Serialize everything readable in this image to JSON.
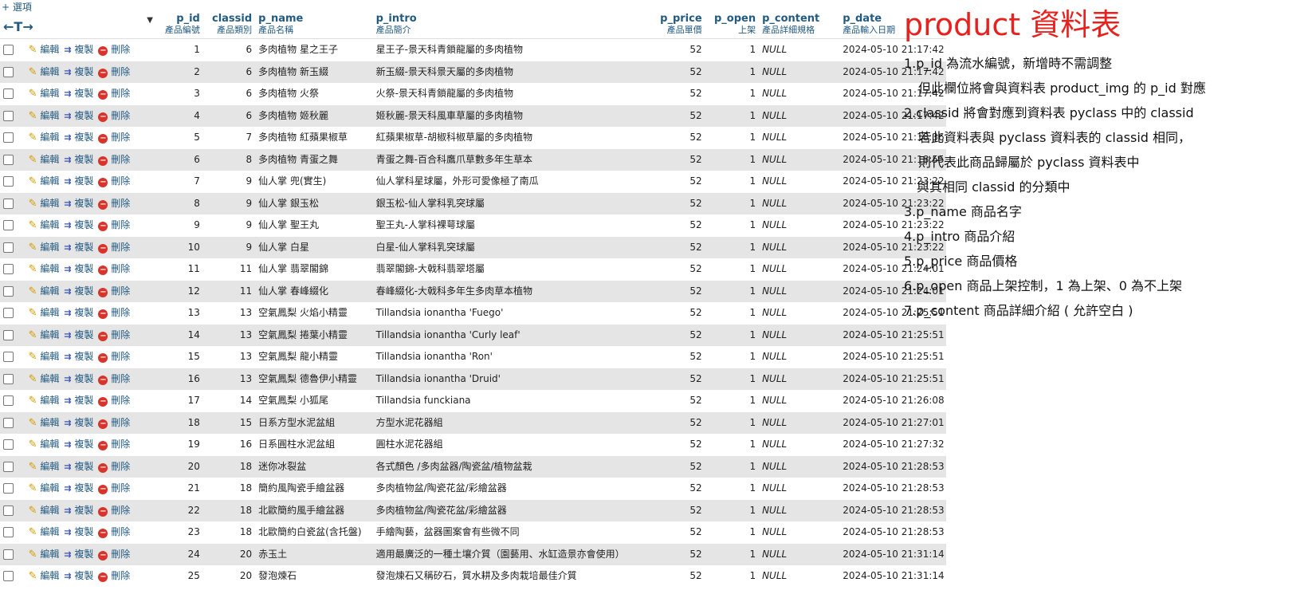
{
  "options_link": "+ 選項",
  "toolbar": {
    "nav_arrows": "←T→"
  },
  "actions": {
    "edit": "編輯",
    "copy": "複製",
    "delete": "刪除"
  },
  "columns": [
    {
      "name": "p_id",
      "desc": "產品編號"
    },
    {
      "name": "classid",
      "desc": "產品類別"
    },
    {
      "name": "p_name",
      "desc": "產品名稱"
    },
    {
      "name": "p_intro",
      "desc": "產品簡介"
    },
    {
      "name": "p_price",
      "desc": "產品單價"
    },
    {
      "name": "p_open",
      "desc": "上架"
    },
    {
      "name": "p_content",
      "desc": "產品詳細規格"
    },
    {
      "name": "p_date",
      "desc": "產品輸入日期"
    }
  ],
  "rows": [
    [
      "1",
      "6",
      "多肉植物 星之王子",
      "星王子-景天科青鎖龍屬的多肉植物",
      "52",
      "1",
      "NULL",
      "2024-05-10 21:17:42"
    ],
    [
      "2",
      "6",
      "多肉植物 新玉綴",
      "新玉綴-景天科景天屬的多肉植物",
      "52",
      "1",
      "NULL",
      "2024-05-10 21:17:42"
    ],
    [
      "3",
      "6",
      "多肉植物 火祭",
      "火祭-景天科青鎖龍屬的多肉植物",
      "52",
      "1",
      "NULL",
      "2024-05-10 21:17:42"
    ],
    [
      "4",
      "6",
      "多肉植物 姬秋麗",
      "姬秋麗-景天科風車草屬的多肉植物",
      "52",
      "1",
      "NULL",
      "2024-05-10 21:17:42"
    ],
    [
      "5",
      "7",
      "多肉植物 紅蘋果椒草",
      "紅蘋果椒草-胡椒科椒草屬的多肉植物",
      "52",
      "1",
      "NULL",
      "2024-05-10 21:18:36"
    ],
    [
      "6",
      "8",
      "多肉植物 青蛋之舞",
      "青蛋之舞-百合科鷹爪草數多年生草本",
      "52",
      "1",
      "NULL",
      "2024-05-10 21:18:55"
    ],
    [
      "7",
      "9",
      "仙人掌 兜(實生)",
      "仙人掌科星球屬，外形可愛像極了南瓜",
      "52",
      "1",
      "NULL",
      "2024-05-10 21:23:22"
    ],
    [
      "8",
      "9",
      "仙人掌 銀玉松",
      "銀玉松-仙人掌科乳突球屬",
      "52",
      "1",
      "NULL",
      "2024-05-10 21:23:22"
    ],
    [
      "9",
      "9",
      "仙人掌 聖王丸",
      "聖王丸-人掌科裸萼球屬",
      "52",
      "1",
      "NULL",
      "2024-05-10 21:23:22"
    ],
    [
      "10",
      "9",
      "仙人掌 白星",
      "白星-仙人掌科乳突球屬",
      "52",
      "1",
      "NULL",
      "2024-05-10 21:23:22"
    ],
    [
      "11",
      "11",
      "仙人掌 翡翠閣錦",
      "翡翠閣錦-大戟科翡翠塔屬",
      "52",
      "1",
      "NULL",
      "2024-05-10 21:24:01"
    ],
    [
      "12",
      "11",
      "仙人掌 春峰綴化",
      "春峰綴化-大戟科多年生多肉草本植物",
      "52",
      "1",
      "NULL",
      "2024-05-10 21:24:01"
    ],
    [
      "13",
      "13",
      "空氣鳳梨 火焰小精靈",
      "Tillandsia ionantha 'Fuego'",
      "52",
      "1",
      "NULL",
      "2024-05-10 21:25:51"
    ],
    [
      "14",
      "13",
      "空氣鳳梨 捲葉小精靈",
      "Tillandsia ionantha 'Curly leaf'",
      "52",
      "1",
      "NULL",
      "2024-05-10 21:25:51"
    ],
    [
      "15",
      "13",
      "空氣鳳梨 龍小精靈",
      "Tillandsia ionantha 'Ron'",
      "52",
      "1",
      "NULL",
      "2024-05-10 21:25:51"
    ],
    [
      "16",
      "13",
      "空氣鳳梨 德魯伊小精靈",
      "Tillandsia ionantha 'Druid'",
      "52",
      "1",
      "NULL",
      "2024-05-10 21:25:51"
    ],
    [
      "17",
      "14",
      "空氣鳳梨 小狐尾",
      "Tillandsia funckiana",
      "52",
      "1",
      "NULL",
      "2024-05-10 21:26:08"
    ],
    [
      "18",
      "15",
      "日系方型水泥盆組",
      "方型水泥花器組",
      "52",
      "1",
      "NULL",
      "2024-05-10 21:27:01"
    ],
    [
      "19",
      "16",
      "日系圓柱水泥盆組",
      "圓柱水泥花器組",
      "52",
      "1",
      "NULL",
      "2024-05-10 21:27:32"
    ],
    [
      "20",
      "18",
      "迷你冰裂盆",
      "各式顏色 /多肉盆器/陶瓷盆/植物盆栽",
      "52",
      "1",
      "NULL",
      "2024-05-10 21:28:53"
    ],
    [
      "21",
      "18",
      "簡約風陶瓷手繪盆器",
      "多肉植物盆/陶瓷花盆/彩繪盆器",
      "52",
      "1",
      "NULL",
      "2024-05-10 21:28:53"
    ],
    [
      "22",
      "18",
      "北歐簡約風手繪盆器",
      "多肉植物盆/陶瓷花盆/彩繪盆器",
      "52",
      "1",
      "NULL",
      "2024-05-10 21:28:53"
    ],
    [
      "23",
      "18",
      "北歐簡約白瓷盆(含托盤)",
      "手繪陶藝，盆器圖案會有些微不同",
      "52",
      "1",
      "NULL",
      "2024-05-10 21:28:53"
    ],
    [
      "24",
      "20",
      "赤玉土",
      "適用最廣泛的一種土壤介質（園藝用、水缸造景亦會使用）",
      "52",
      "1",
      "NULL",
      "2024-05-10 21:31:14"
    ],
    [
      "25",
      "20",
      "發泡煉石",
      "發泡煉石又稱矽石，質水耕及多肉栽培最佳介質",
      "52",
      "1",
      "NULL",
      "2024-05-10 21:31:14"
    ]
  ],
  "notes": {
    "title": "product 資料表",
    "lines": [
      {
        "text": "1.p_id 為流水編號，新增時不需調整",
        "indent": 0
      },
      {
        "text": "但此欄位將會與資料表 product_img 的 p_id 對應",
        "indent": 1
      },
      {
        "text": "2.classid 將會對應到資料表 pyclass 中的 classid",
        "indent": 0
      },
      {
        "text": "若此資料表與 pyclass 資料表的 classid 相同，",
        "indent": 1
      },
      {
        "text": "則代表此商品歸屬於 pyclass 資料表中",
        "indent": 1
      },
      {
        "text": "與其相同 classid 的分類中",
        "indent": 2
      },
      {
        "text": "3.p_name 商品名字",
        "indent": 0
      },
      {
        "text": "4.p_intro 商品介紹",
        "indent": 0
      },
      {
        "text": "5.p_price 商品價格",
        "indent": 0
      },
      {
        "text": "6.p_open 商品上架控制，1 為上架、0 為不上架",
        "indent": 0
      },
      {
        "text": "7.p_content 商品詳細介紹 ( 允許空白 )",
        "indent": 0
      }
    ]
  }
}
